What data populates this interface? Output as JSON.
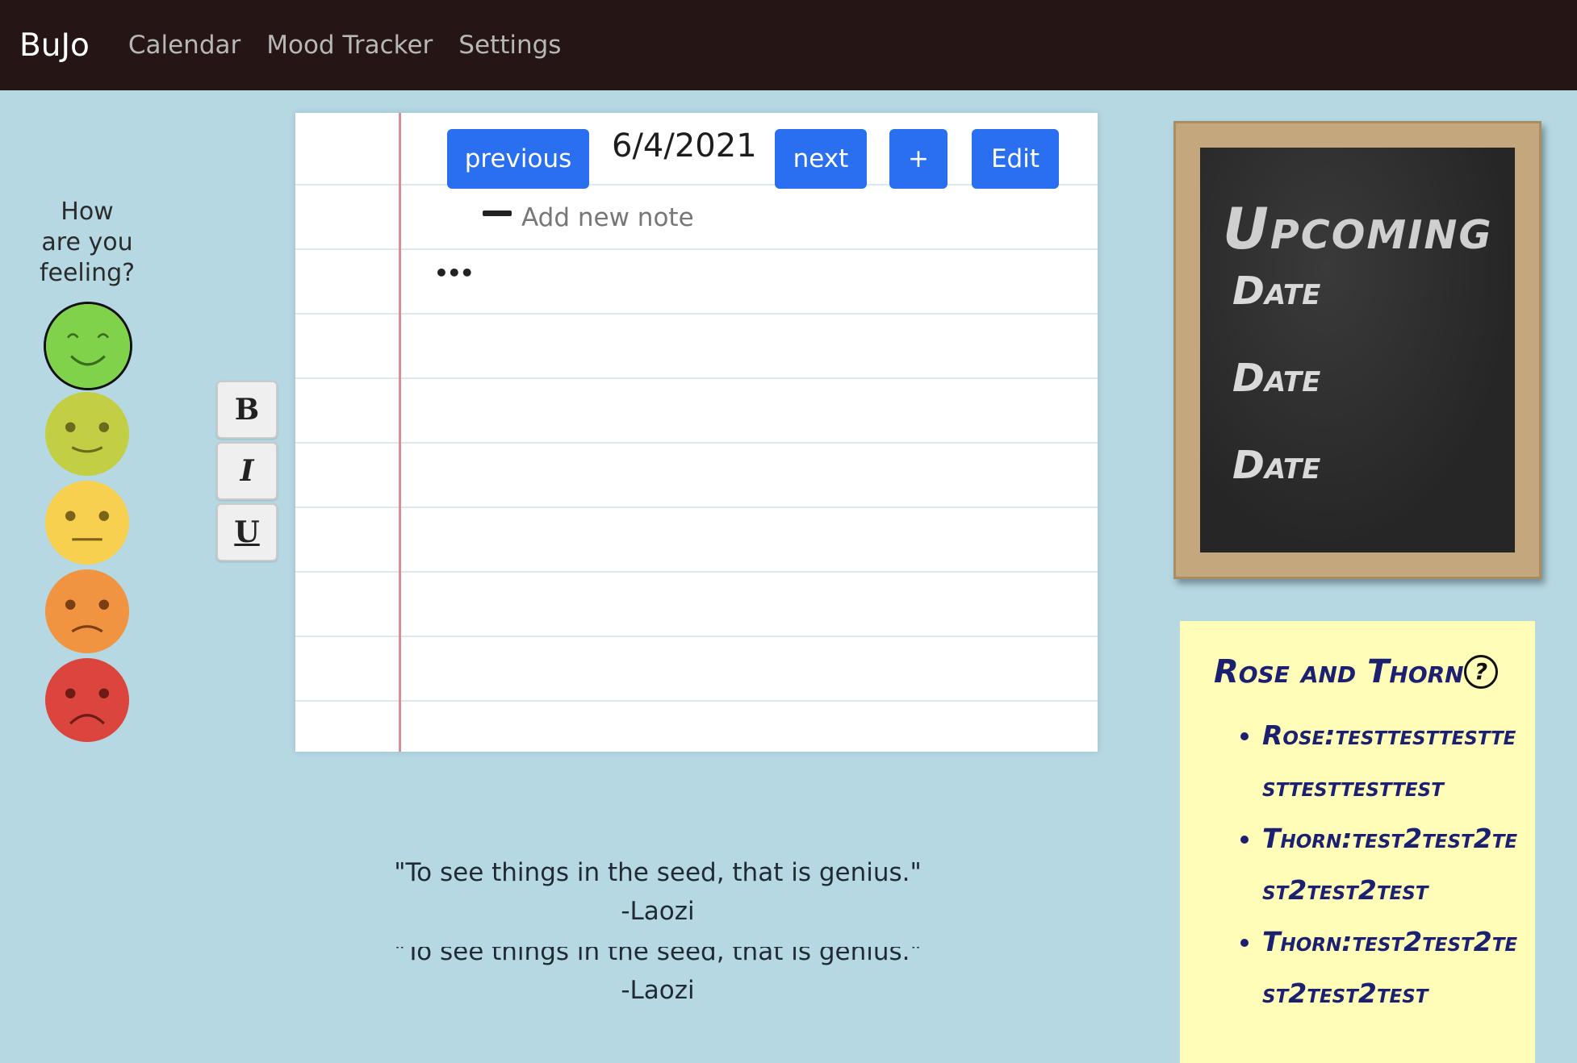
{
  "navbar": {
    "brand": "BuJo",
    "links": [
      "Calendar",
      "Mood Tracker",
      "Settings"
    ]
  },
  "mood": {
    "question_lines": [
      "How",
      "are you",
      "feeling?"
    ],
    "faces": [
      {
        "name": "very-happy",
        "color": "#7fd24a",
        "selected": true
      },
      {
        "name": "happy",
        "color": "#c2cf44",
        "selected": false
      },
      {
        "name": "neutral",
        "color": "#f8d050",
        "selected": false
      },
      {
        "name": "sad",
        "color": "#f09442",
        "selected": false
      },
      {
        "name": "very-sad",
        "color": "#dc443e",
        "selected": false
      }
    ]
  },
  "format": {
    "bold": "B",
    "italic": "I",
    "underline": "U"
  },
  "notebook": {
    "previous_label": "previous",
    "date": "6/4/2021",
    "next_label": "next",
    "add_label": "+",
    "edit_label": "Edit",
    "new_note_placeholder": "Add new note",
    "more_label": "•••"
  },
  "quotes": [
    {
      "text": "\"To see things in the seed, that is genius.\"",
      "author": "-Laozi"
    },
    {
      "text": "\"To see things in the seed, that is genius.\"",
      "author": "-Laozi"
    }
  ],
  "upcoming": {
    "title": "Upcoming",
    "dates": [
      "Date",
      "Date",
      "Date"
    ]
  },
  "rose_thorn": {
    "title": "Rose and Thorn",
    "help_icon": "?",
    "items": [
      "Rose:testtesttesttesttesttesttest",
      "Thorn:test2test2test2test2test",
      "Thorn:test2test2test2test2test"
    ]
  },
  "colors": {
    "navbar_bg": "#261515",
    "page_bg": "#b5d8e3",
    "button_blue": "#2a6ff0",
    "sticky_bg": "#fffdb8",
    "chalk_ink": "#1b2070"
  }
}
